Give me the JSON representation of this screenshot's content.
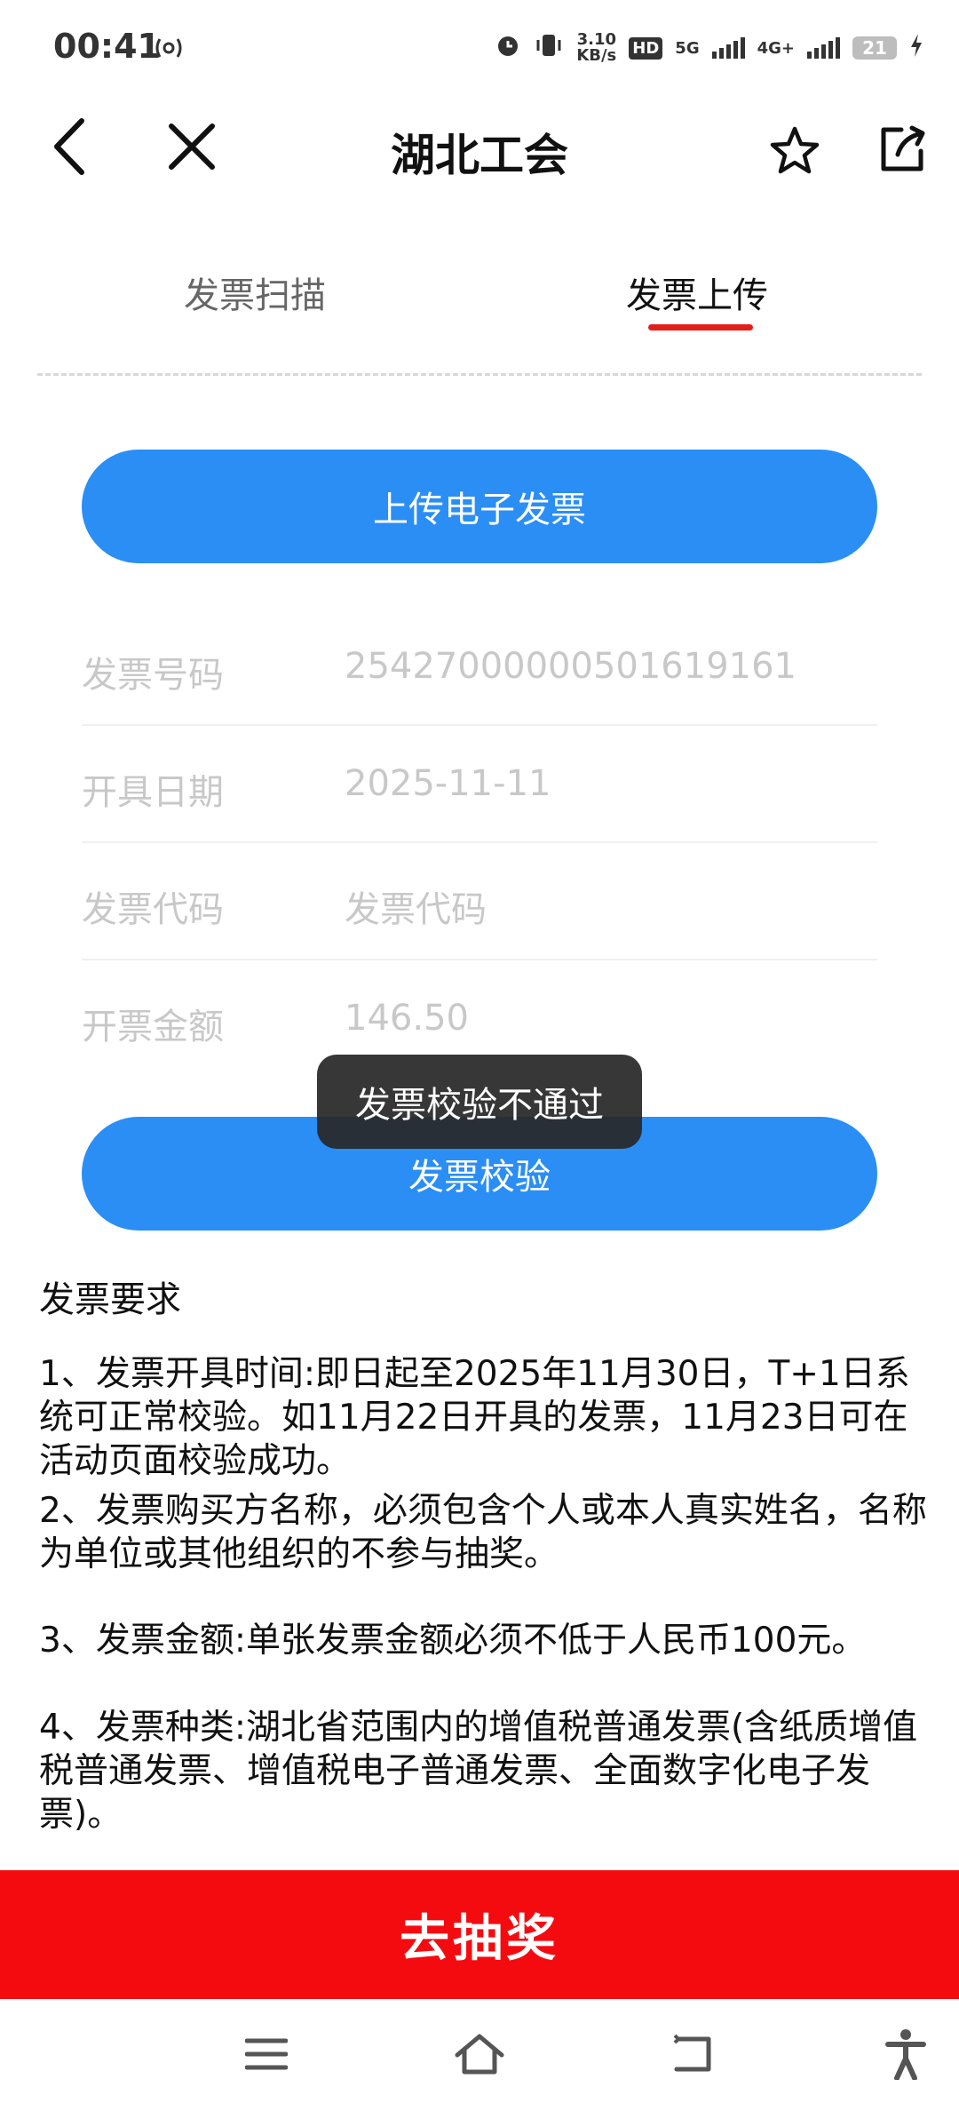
{
  "status_bar": {
    "time": "00:41",
    "net_speed_value": "3.10",
    "net_speed_unit": "KB/s",
    "hd_label": "HD",
    "sim1_label": "5G",
    "sim2_label": "4G+",
    "battery": "21"
  },
  "header": {
    "title": "湖北工会"
  },
  "tabs": [
    {
      "label": "发票扫描",
      "active": false
    },
    {
      "label": "发票上传",
      "active": true
    }
  ],
  "upload_button": "上传电子发票",
  "form": {
    "invoice_number": {
      "label": "发票号码",
      "value": "25427000000501619161"
    },
    "issue_date": {
      "label": "开具日期",
      "value": "2025-11-11"
    },
    "invoice_code": {
      "label": "发票代码",
      "placeholder": "发票代码"
    },
    "amount": {
      "label": "开票金额",
      "value": "146.50"
    }
  },
  "verify_button": "发票校验",
  "toast": "发票校验不通过",
  "requirements": {
    "title": "发票要求",
    "items": [
      "1、发票开具时间:即日起至2025年11月30日，T+1日系统可正常校验。如11月22日开具的发票，11月23日可在活动页面校验成功。",
      "2、发票购买方名称，必须包含个人或本人真实姓名，名称为单位或其他组织的不参与抽奖。",
      "3、发票金额:单张发票金额必须不低于人民币100元。",
      "4、发票种类:湖北省范围内的增值税普通发票(含纸质增值税普通发票、增值税电子普通发票、全面数字化电子发票)。"
    ]
  },
  "draw_button": "去抽奖",
  "colors": {
    "accent_blue": "#2a8ef5",
    "tab_underline_red": "#e1201c",
    "draw_button_red": "#f40b10"
  }
}
